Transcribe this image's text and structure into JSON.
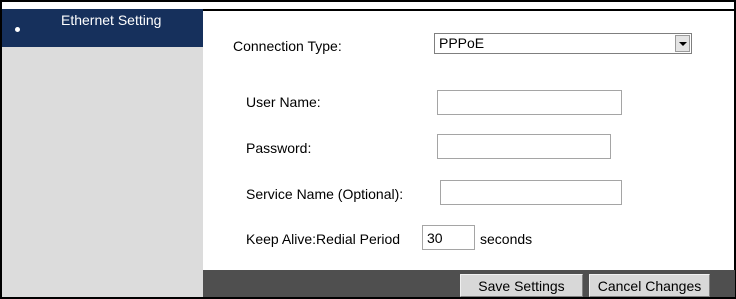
{
  "sidebar": {
    "items": [
      {
        "label": "Ethernet Setting"
      }
    ]
  },
  "form": {
    "connection_type": {
      "label": "Connection Type:",
      "value": "PPPoE"
    },
    "user_name": {
      "label": "User Name:",
      "value": ""
    },
    "password": {
      "label": "Password:",
      "value": ""
    },
    "service_name": {
      "label": "Service Name (Optional):",
      "value": ""
    },
    "keep_alive": {
      "label": "Keep Alive:Redial Period",
      "value": "30",
      "unit": "seconds"
    }
  },
  "buttons": {
    "save": "Save Settings",
    "cancel": "Cancel Changes"
  },
  "colors": {
    "sidebar_active": "#16305c",
    "sidebar_bg": "#dcdcdc",
    "footer_bg": "#4f4f4f"
  }
}
